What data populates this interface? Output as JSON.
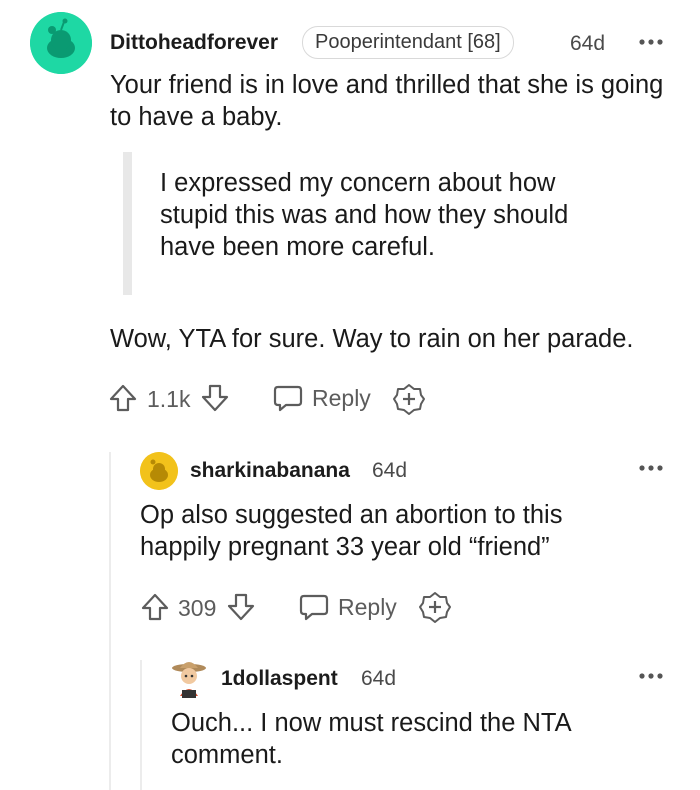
{
  "comments": [
    {
      "username": "Dittoheadforever",
      "flair": "Pooperintendant [68]",
      "age": "64d",
      "more_icon": "ellipsis-icon",
      "text1": "Your friend is in love and thrilled that she is going to have a baby.",
      "quote": "I expressed my concern about how stupid this was and how they should have been more careful.",
      "text2": "Wow, YTA for sure. Way to rain on her parade.",
      "score": "1.1k",
      "reply_label": "Reply",
      "avatar_color": "#1ed8a4"
    },
    {
      "username": "sharkinabanana",
      "age": "64d",
      "more_icon": "ellipsis-icon",
      "text": "Op also suggested an abortion to this happily pregnant 33 year old “friend”",
      "score": "309",
      "reply_label": "Reply",
      "avatar_color": "#f2c21b"
    },
    {
      "username": "1dollaspent",
      "age": "64d",
      "more_icon": "ellipsis-icon",
      "text": "Ouch... I now must rescind the NTA comment."
    }
  ]
}
